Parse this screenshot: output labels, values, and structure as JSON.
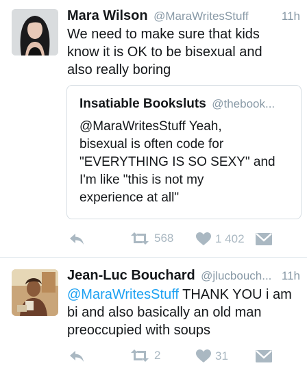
{
  "tweets": [
    {
      "name": "Mara Wilson",
      "handle": "@MaraWritesStuff",
      "time": "11h",
      "text_lines": [
        "We need to make sure that kids",
        "know it is OK to be bisexual and",
        "also really boring"
      ],
      "quote": {
        "name": "Insatiable Booksluts",
        "handle": "@thebook...",
        "text_lines": [
          "@MaraWritesStuff Yeah,",
          "bisexual is often code for",
          "\"EVERYTHING IS SO SEXY\" and",
          "I'm like \"this is not my",
          "experience at all\""
        ]
      },
      "retweets": "568",
      "likes": "1 402"
    },
    {
      "name": "Jean-Luc Bouchard",
      "handle": "@jlucbouch...",
      "time": "11h",
      "mention": "@MaraWritesStuff",
      "text_after_mention": " THANK YOU i am",
      "text_lines": [
        "bi and also basically an old man",
        "preoccupied with soups"
      ],
      "retweets": "2",
      "likes": "31"
    }
  ],
  "colors": {
    "link": "#1da1f2",
    "muted": "#8899a6",
    "action": "#aab8c2",
    "border": "#d6dde3"
  },
  "icons": [
    "reply-icon",
    "retweet-icon",
    "like-icon",
    "direct-message-icon"
  ]
}
